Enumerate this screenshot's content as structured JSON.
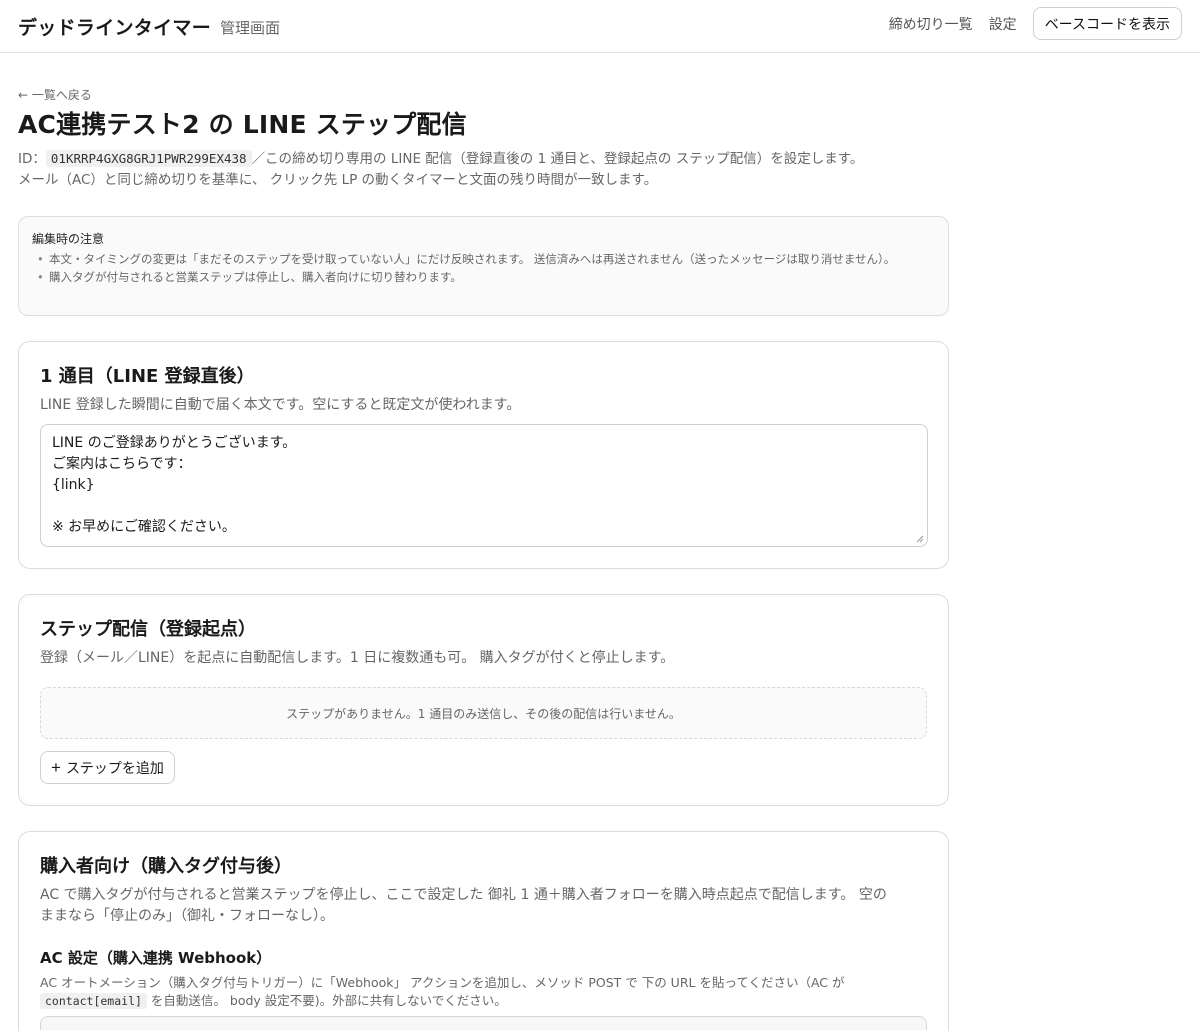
{
  "header": {
    "brand": "デッドラインタイマー",
    "subtitle": "管理画面",
    "nav": {
      "deadlines": "締め切り一覧",
      "settings": "設定",
      "show_base_code": "ベースコードを表示"
    }
  },
  "page": {
    "back_link": "← 一覧へ戻る",
    "title": "AC連携テスト2 の LINE ステップ配信",
    "id_label": "ID：",
    "id_value": "01KRRP4GXG8GRJ1PWR299EX438",
    "desc_line1": "／この締め切り専用の LINE 配信（登録直後の 1 通目と、登録起点の ステップ配信）を設定します。",
    "desc_line2": "メール（AC）と同じ締め切りを基準に、 クリック先 LP の動くタイマーと文面の残り時間が一致します。"
  },
  "notice": {
    "title": "編集時の注意",
    "items": [
      "本文・タイミングの変更は「まだそのステップを受け取っていない人」にだけ反映されます。 送信済みへは再送されません（送ったメッセージは取り消せません）。",
      "購入タグが付与されると営業ステップは停止し、購入者向けに切り替わります。"
    ]
  },
  "first_message": {
    "title": "1 通目（LINE 登録直後）",
    "description": "LINE 登録した瞬間に自動で届く本文です。空にすると既定文が使われます。",
    "body": "LINE のご登録ありがとうございます。\nご案内はこちらです：\n{link}\n\n※ お早めにご確認ください。"
  },
  "step_delivery": {
    "title": "ステップ配信（登録起点）",
    "description": "登録（メール／LINE）を起点に自動配信します。1 日に複数通も可。 購入タグが付くと停止します。",
    "empty_message": "ステップがありません。1 通目のみ送信し、その後の配信は行いません。",
    "add_button": "ステップを追加",
    "add_icon": "+"
  },
  "purchaser": {
    "title": "購入者向け（購入タグ付与後）",
    "description_line1": "AC で購入タグが付与されると営業ステップを停止し、ここで設定した 御礼 1 通＋購入者フォローを購入時点起点で配信します。 空の",
    "description_line2": "ままなら「停止のみ」（御礼・フォローなし）。",
    "ac_settings_title": "AC 設定（購入連携 Webhook）",
    "ac_desc_line1": "AC オートメーション（購入タグ付与トリガー）に「Webhook」 アクションを追加し、メソッド POST で 下の URL を貼ってください（AC が",
    "ac_desc_code": "contact[email]",
    "ac_desc_line2": "を自動送信。 body 設定不要)。外部に共有しないでください。"
  }
}
